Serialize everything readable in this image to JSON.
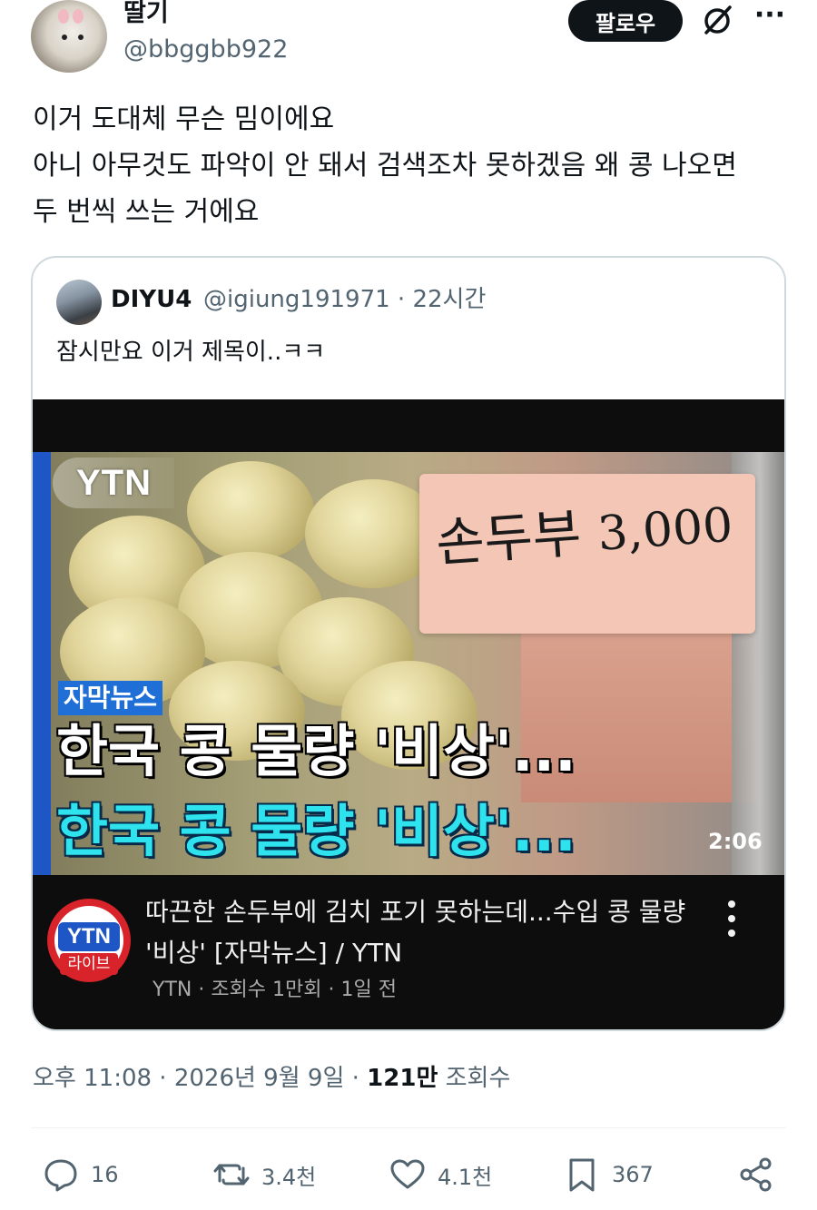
{
  "author": {
    "display_name": "딸기",
    "handle": "@bbggbb922",
    "follow_label": "팔로우"
  },
  "tweet": {
    "lines": [
      "이거 도대체 무슨 밈이에요",
      "아니 아무것도 파악이 안 돼서 검색조차 못하겠음 왜 콩 나오면",
      "두 번씩 쓰는 거에요"
    ]
  },
  "quote": {
    "name": "DIYU4",
    "meta": "@igiung191971 · 22시간",
    "text": "잠시만요 이거 제목이..ㅋㅋ",
    "video": {
      "channel_logo": "YTN",
      "sign_text": "손두부",
      "sign_price": "3,000",
      "caption_tag": "자막뉴스",
      "headline_white": "한국 콩 물량 '비상'...",
      "headline_cyan": "한국 콩 물량 '비상'...",
      "duration": "2:06",
      "channel_avatar_top": "YTN",
      "channel_avatar_bottom": "라이브",
      "title": "따끈한 손두부에 김치 포기 못하는데...수입 콩 물량 '비상' [자막뉴스] / YTN",
      "meta": "YTN · 조회수 1만회 · 1일 전"
    }
  },
  "timestamp": {
    "time_date": "오후 11:08 · 2026년 9월 9일 · ",
    "views_count": "121만",
    "views_label": " 조회수"
  },
  "actions": {
    "replies": "16",
    "retweets": "3.4천",
    "likes": "4.1천",
    "bookmarks": "367"
  },
  "icons": [
    "grok-icon",
    "more-icon",
    "reply-icon",
    "retweet-icon",
    "like-icon",
    "bookmark-icon",
    "share-icon"
  ]
}
